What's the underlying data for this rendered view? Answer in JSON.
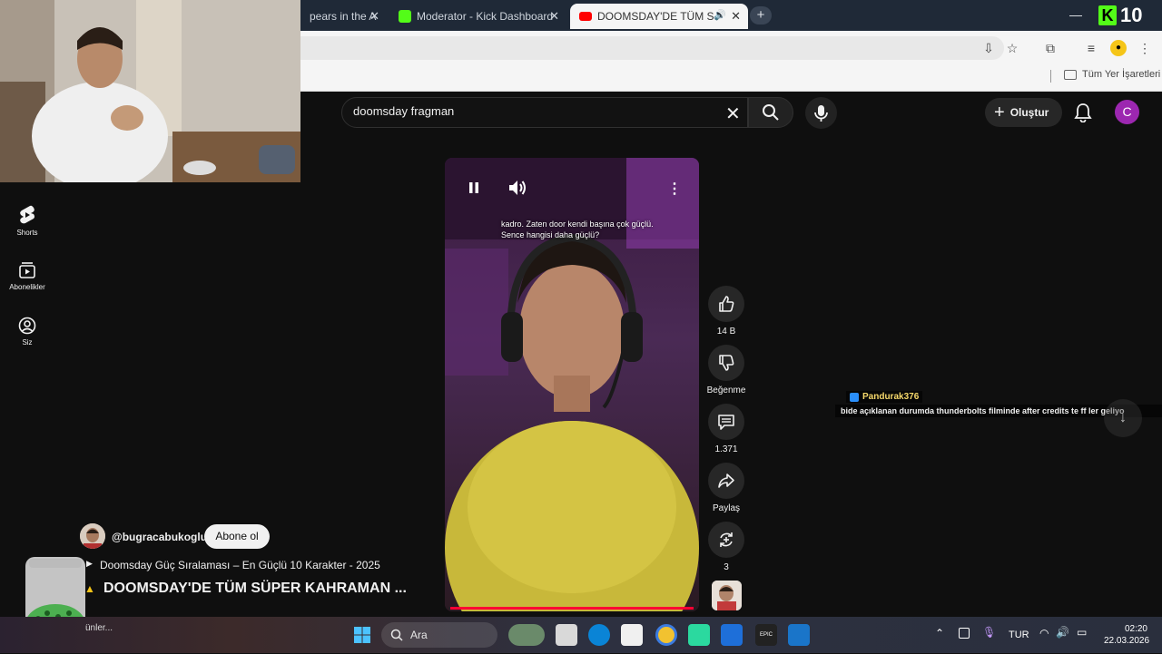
{
  "browser": {
    "tabs": [
      {
        "title": "pears in the A",
        "favicon_color": "#e0e0e0"
      },
      {
        "title": "Moderator - Kick Dashboard",
        "favicon_color": "#53fc18"
      },
      {
        "title": "DOOMSDAY'DE TÜM S",
        "favicon_color": "#ff0000"
      }
    ],
    "bookmarks_all": "Tüm Yer İşaretleri",
    "kick_badge": "10"
  },
  "youtube": {
    "search_value": "doomsday fragman",
    "create_label": "Oluştur",
    "avatar_letter": "C"
  },
  "sidebar": {
    "items": [
      {
        "label": "Shorts",
        "icon": "shorts-icon"
      },
      {
        "label": "Abonelikler",
        "icon": "subscriptions-icon"
      },
      {
        "label": "Siz",
        "icon": "you-icon"
      }
    ]
  },
  "short": {
    "caption": "kadro. Zaten door kendi başına çok güçlü. Sence hangisi daha güçlü?",
    "likes": "14 B",
    "dislike_label": "Beğenme",
    "comments": "1.371",
    "share_label": "Paylaş",
    "remix_count": "3",
    "channel": "@bugracabukoglu",
    "subscribe_label": "Abone ol",
    "playlist": "Doomsday Güç Sıralaması – En Güçlü 10 Karakter - 2025",
    "title": "DOOMSDAY'DE TÜM SÜPER KAHRAMAN ..."
  },
  "chat": {
    "user": "Pandurak376",
    "message": "bide açıklanan durumda thunderbolts filminde after credits te ff ler geliyo"
  },
  "taskbar": {
    "search_label": "Ara",
    "language": "TUR",
    "time": "02:20",
    "date": "22.03.2026",
    "weather_text": "ünler..."
  }
}
